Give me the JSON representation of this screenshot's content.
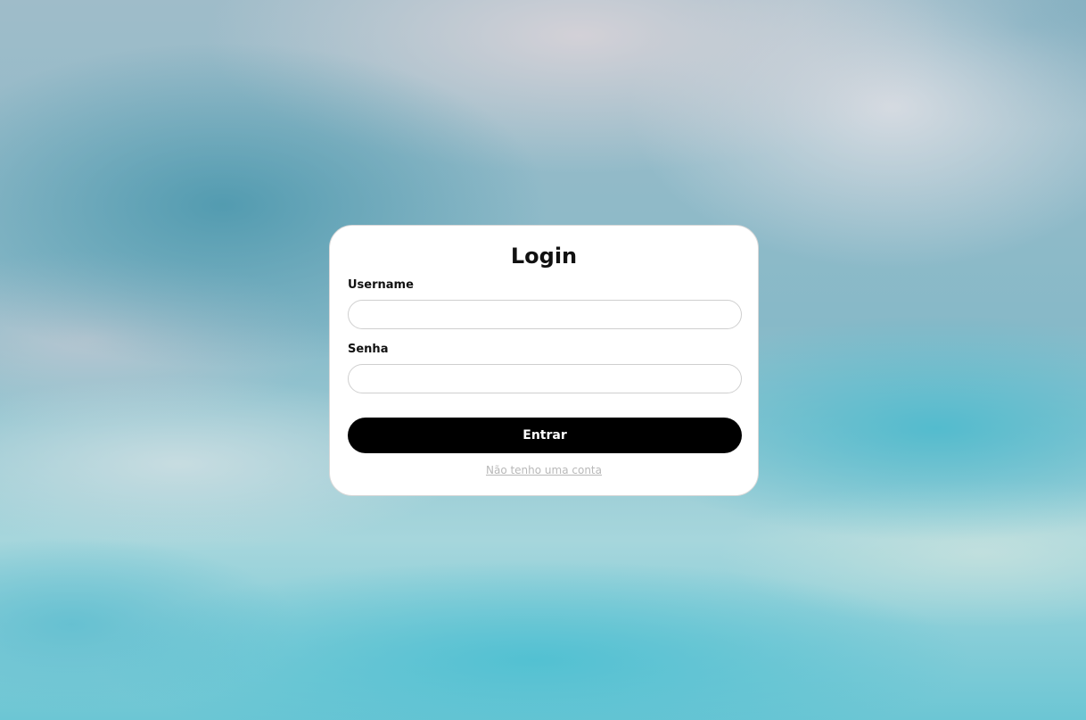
{
  "login": {
    "title": "Login",
    "username_label": "Username",
    "username_value": "",
    "password_label": "Senha",
    "password_value": "",
    "submit_label": "Entrar",
    "signup_link": "Não tenho uma conta"
  },
  "colors": {
    "card_background": "#ffffff",
    "button_background": "#000000",
    "button_text": "#ffffff",
    "link_text": "#b8b8b8"
  }
}
